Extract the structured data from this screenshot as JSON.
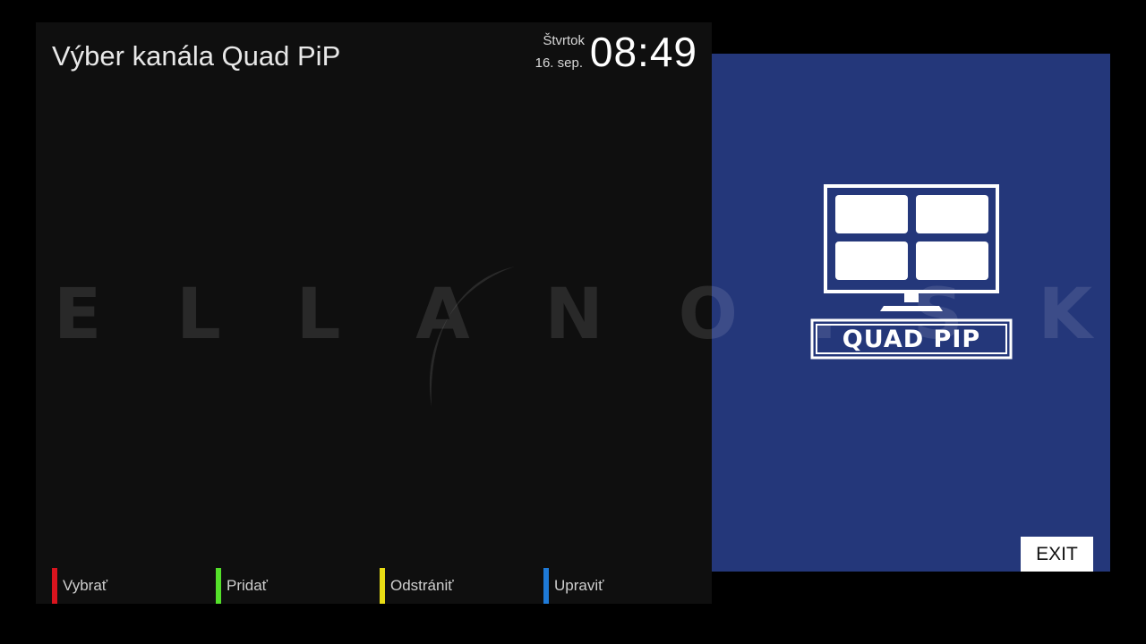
{
  "header": {
    "title": "Výber kanála Quad PiP",
    "day": "Štvrtok",
    "date": "16. sep.",
    "time": "08:49"
  },
  "color_keys": [
    {
      "label": "Vybrať",
      "color": "#d9141e"
    },
    {
      "label": "Pridať",
      "color": "#54e02a"
    },
    {
      "label": "Odstrániť",
      "color": "#e8dc14"
    },
    {
      "label": "Upraviť",
      "color": "#1e7ad8"
    }
  ],
  "preview": {
    "background": "#24377a",
    "logo_text": "QUAD PIP",
    "logo_icon": "quad-screen-monitor-icon"
  },
  "exit_button": {
    "label": "EXIT"
  },
  "watermark": {
    "text": "ELLANO.SK"
  }
}
